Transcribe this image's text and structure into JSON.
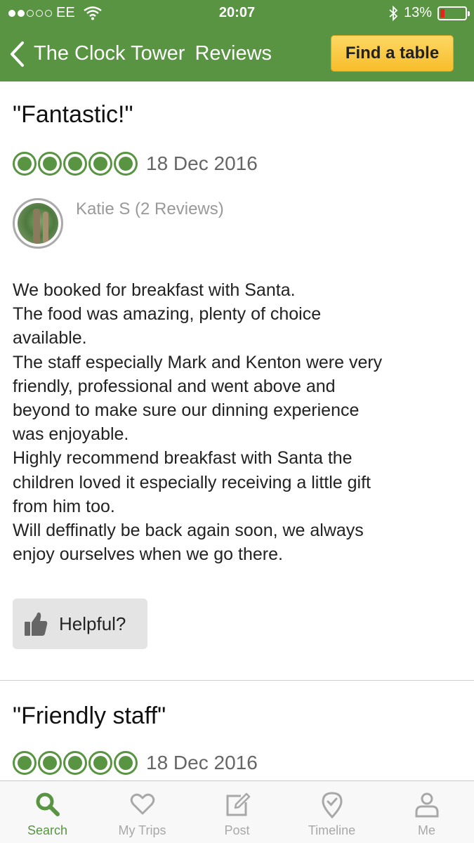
{
  "status_bar": {
    "carrier": "EE",
    "time": "20:07",
    "battery": "13%"
  },
  "nav": {
    "back_title": "The Clock Tower",
    "screen_title": "Reviews",
    "find_table_label": "Find a table"
  },
  "reviews": [
    {
      "title": "\"Fantastic!\"",
      "rating": 5,
      "date": "18 Dec 2016",
      "author": "Katie S (2 Reviews)",
      "body": [
        "We booked for breakfast with Santa.",
        "The food was amazing, plenty of choice",
        "available.",
        "The staff especially Mark and Kenton were very",
        "friendly, professional and went above and",
        "beyond to make sure our dinning experience",
        "was enjoyable.",
        "Highly recommend breakfast with Santa the",
        "children loved it especially receiving a little gift",
        "from him too.",
        "Will deffinatly be back again soon, we always",
        "enjoy ourselves when we go there."
      ],
      "helpful_label": "Helpful?"
    },
    {
      "title": "\"Friendly staff\"",
      "rating": 5,
      "date": "18 Dec 2016"
    }
  ],
  "tabs": [
    {
      "label": "Search",
      "icon": "search-icon",
      "active": true
    },
    {
      "label": "My Trips",
      "icon": "heart-icon",
      "active": false
    },
    {
      "label": "Post",
      "icon": "edit-icon",
      "active": false
    },
    {
      "label": "Timeline",
      "icon": "location-pin-icon",
      "active": false
    },
    {
      "label": "Me",
      "icon": "person-icon",
      "active": false
    }
  ],
  "colors": {
    "brand_green": "#589442",
    "find_table_yellow": "#f7bd2a",
    "battery_low": "#e0251b"
  }
}
